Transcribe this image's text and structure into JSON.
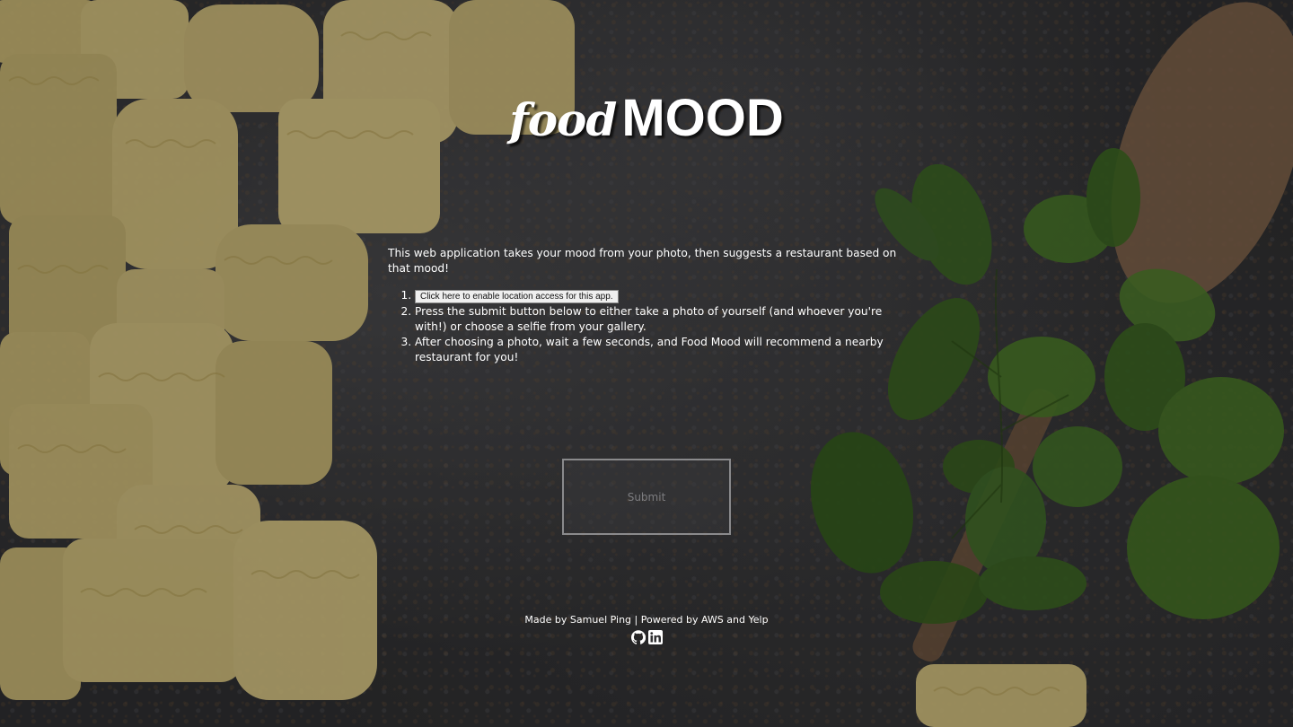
{
  "logo": {
    "food": "food",
    "mood": "MOOD"
  },
  "intro": "This web application takes your mood from your photo, then suggests a restaurant based on that mood!",
  "location_button_label": "Click here to enable location access for this app.",
  "steps": [
    "Press the submit button below to either take a photo of yourself (and whoever you're with!) or choose a selfie from your gallery.",
    "After choosing a photo, wait a few seconds, and Food Mood will recommend a nearby restaurant for you!"
  ],
  "submit_label": "Submit",
  "footer": {
    "made_by_prefix": "Made by ",
    "author": "Samuel Ping",
    "separator": " | Powered by ",
    "aws": "AWS",
    "and": " and ",
    "yelp": "Yelp"
  },
  "social_icons": [
    "github-icon",
    "linkedin-icon"
  ],
  "colors": {
    "text": "#ffffff",
    "submit_border": "#8a8a8c",
    "submit_text": "#7d7d80",
    "background": "#303032"
  }
}
